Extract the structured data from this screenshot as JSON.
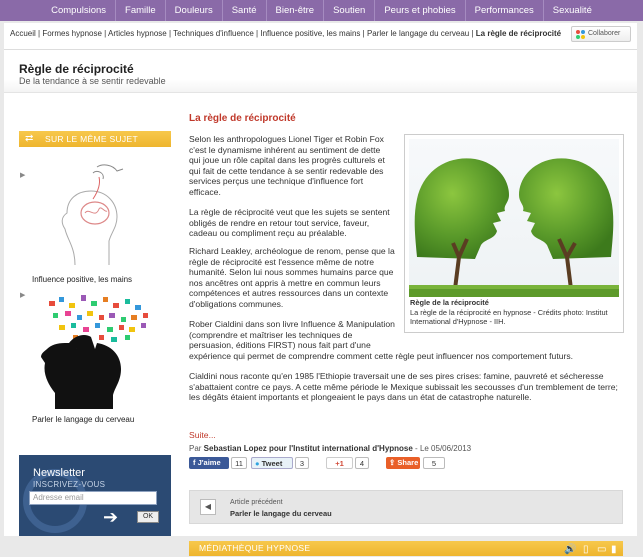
{
  "nav": [
    "Compulsions",
    "Famille",
    "Douleurs",
    "Santé",
    "Bien-être",
    "Soutien",
    "Peurs et phobies",
    "Performances",
    "Sexualité"
  ],
  "breadcrumb": {
    "items": [
      "Accueil",
      "Formes hypnose",
      "Articles hypnose",
      "Techniques d'influence",
      "Influence positive, les mains",
      "Parler le langage du cerveau"
    ],
    "current": "La règle de réciprocité",
    "separator": " | "
  },
  "collab_button": "Collaborer",
  "page": {
    "title": "Règle de réciprocité",
    "subtitle": "De la tendance à se sentir redevable"
  },
  "sidebar": {
    "heading": "SUR LE MÊME SUJET",
    "related": [
      {
        "label": "Influence positive, les mains"
      },
      {
        "label": "Parler le langage du cerveau"
      }
    ]
  },
  "newsletter": {
    "title": "Newsletter",
    "subtitle": "INSCRIVEZ-VOUS",
    "placeholder": "Adresse email",
    "ok": "OK"
  },
  "article": {
    "title": "La règle de réciprocité",
    "paragraphs": [
      [
        "Selon les anthropologues Lionel Tiger et Robin Fox",
        "c'est le dynamisme inhérent au sentiment de dette",
        "qui joue un rôle capital dans les progrès culturels et",
        "qui fait de cette tendance à se sentir redevable des",
        "services perçus une technique d'influence fort",
        "efficace."
      ],
      [
        "La règle de réciprocité veut que les sujets se sentent",
        "obligés de rendre en retour tout service, faveur,",
        "cadeau ou compliment reçu au préalable."
      ],
      [
        "Richard Leakley, archéologue de renom, pense que la",
        "règle de réciprocité est l'essence même de notre",
        "humanité. Selon lui nous sommes humains parce que",
        "nos ancêtres ont appris à mettre en commun leurs",
        "compétences et autres ressources dans un contexte",
        "d'obligations communes."
      ],
      [
        "Rober Cialdini dans son livre Influence & Manipulation",
        "(comprendre et maîtriser les techniques de",
        "persuasion, éditions FIRST) nous fait part d'une",
        "expérience qui permet de comprendre comment cette règle peut influencer nos comportement futurs."
      ],
      [
        "Cialdini nous raconte qu'en 1985 l'Ethiopie traversait une de ses pires crises: famine, pauvreté et sécheresse",
        "s'abattaient contre ce pays. A cette même période le Mexique subissait les secousses d'un tremblement de terre;",
        "les dégâts étaient importants et plongeaient le pays dans un état de catastrophe naturelle."
      ]
    ],
    "figure_caption_title": "Règle de la réciprocité",
    "figure_caption": "La règle de la réciprocité en hypnose - Crédits photo: Institut International d'Hypnose - IIH.",
    "more": "Suite...",
    "byline_prefix": "Par ",
    "byline_author": "Sebastian Lopez pour l'Institut international d'Hypnose",
    "byline_date": " - Le 05/06/2013"
  },
  "share": {
    "facebook_label": "J'aime",
    "facebook_count": "11",
    "tweet_label": "Tweet",
    "tweet_count": "3",
    "gplus_label": "+1",
    "gplus_count": "4",
    "share_label": "Share",
    "share_count": "5"
  },
  "previous": {
    "label": "Article précédent",
    "title": "Parler le langage du cerveau"
  },
  "media_heading": "MÉDIATHÈQUE HYPNOSE",
  "colors": {
    "nav": "#8a6aa8",
    "accent_red": "#c0392b",
    "yellow": "#f2bd3b",
    "newsletter": "#2b4a73"
  }
}
